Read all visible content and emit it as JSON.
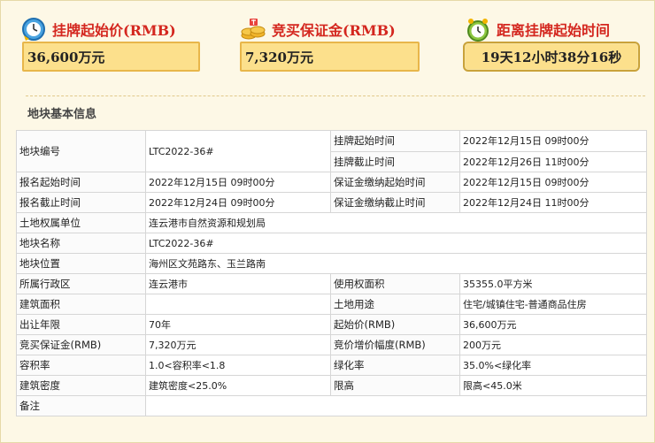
{
  "stats": {
    "start_price": {
      "title": "挂牌起始价(RMB)",
      "value": "36,600万元"
    },
    "deposit": {
      "title": "竞买保证金(RMB)",
      "value": "7,320万元"
    },
    "countdown": {
      "title": "距离挂牌起始时间",
      "value": "19天12小时38分16秒"
    }
  },
  "section_title": "地块基本信息",
  "table": {
    "parcel_no": {
      "label": "地块编号",
      "value": "LTC2022-36#"
    },
    "listing_start": {
      "label": "挂牌起始时间",
      "value": "2022年12月15日 09时00分"
    },
    "listing_end": {
      "label": "挂牌截止时间",
      "value": "2022年12月26日 11时00分"
    },
    "reg_start": {
      "label": "报名起始时间",
      "value": "2022年12月15日 09时00分"
    },
    "deposit_start": {
      "label": "保证金缴纳起始时间",
      "value": "2022年12月15日 09时00分"
    },
    "reg_end": {
      "label": "报名截止时间",
      "value": "2022年12月24日 09时00分"
    },
    "deposit_end": {
      "label": "保证金缴纳截止时间",
      "value": "2022年12月24日 11时00分"
    },
    "owner_unit": {
      "label": "土地权属单位",
      "value": "连云港市自然资源和规划局"
    },
    "parcel_name": {
      "label": "地块名称",
      "value": "LTC2022-36#"
    },
    "location": {
      "label": "地块位置",
      "value": "海州区文苑路东、玉兰路南"
    },
    "district": {
      "label": "所属行政区",
      "value": "连云港市"
    },
    "use_area": {
      "label": "使用权面积",
      "value": "35355.0平方米"
    },
    "building_area": {
      "label": "建筑面积",
      "value": ""
    },
    "land_use": {
      "label": "土地用途",
      "value": "住宅/城镇住宅-普通商品住房"
    },
    "lease_term": {
      "label": "出让年限",
      "value": "70年"
    },
    "start_price": {
      "label": "起始价(RMB)",
      "value": "36,600万元"
    },
    "deposit": {
      "label": "竞买保证金(RMB)",
      "value": "7,320万元"
    },
    "increment": {
      "label": "竞价增价幅度(RMB)",
      "value": "200万元"
    },
    "far": {
      "label": "容积率",
      "value": "1.0<容积率<1.8"
    },
    "green_ratio": {
      "label": "绿化率",
      "value": "35.0%<绿化率"
    },
    "density": {
      "label": "建筑密度",
      "value": "建筑密度<25.0%"
    },
    "height_limit": {
      "label": "限高",
      "value": "限高<45.0米"
    },
    "remarks": {
      "label": "备注",
      "value": ""
    }
  },
  "colors": {
    "title_red": "#d4271f",
    "box_fill": "#fce08c",
    "box_border": "#e8b64a"
  },
  "icons": [
    "clock-icon",
    "coins-icon",
    "alarm-clock-icon"
  ]
}
